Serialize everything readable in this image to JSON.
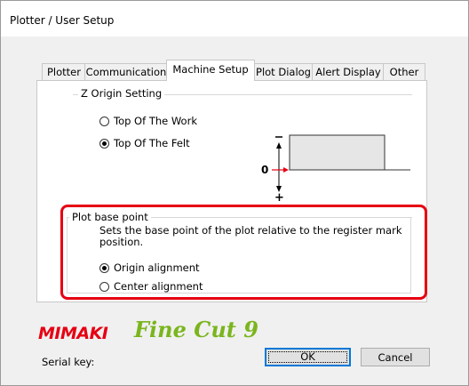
{
  "window": {
    "title": "Plotter / User Setup"
  },
  "tabs": [
    {
      "label": "Plotter",
      "active": false
    },
    {
      "label": "Communication",
      "active": false
    },
    {
      "label": "Machine Setup",
      "active": true
    },
    {
      "label": "Plot Dialog",
      "active": false
    },
    {
      "label": "Alert Display",
      "active": false
    },
    {
      "label": "Other",
      "active": false
    }
  ],
  "z_origin": {
    "group_label": "Z Origin Setting",
    "options": [
      {
        "label": "Top Of The Work",
        "checked": false
      },
      {
        "label": "Top Of The Felt",
        "checked": true
      }
    ],
    "diagram": {
      "minus": "−",
      "zero": "0",
      "plus": "+"
    }
  },
  "plot_base_point": {
    "group_label": "Plot base point",
    "description": "Sets the base point of the plot relative to the register mark position.",
    "options": [
      {
        "label": "Origin alignment",
        "checked": true
      },
      {
        "label": "Center alignment",
        "checked": false
      }
    ]
  },
  "brand": {
    "maker": "MIMAKI",
    "product": "Fine Cut 9"
  },
  "footer": {
    "serial_key_label": "Serial key:"
  },
  "buttons": {
    "ok": "OK",
    "cancel": "Cancel"
  },
  "colors": {
    "highlight": "#e60012",
    "mimaki_red": "#e60012",
    "finecut_green": "#7ab51d",
    "focus_blue": "#0078d7"
  }
}
